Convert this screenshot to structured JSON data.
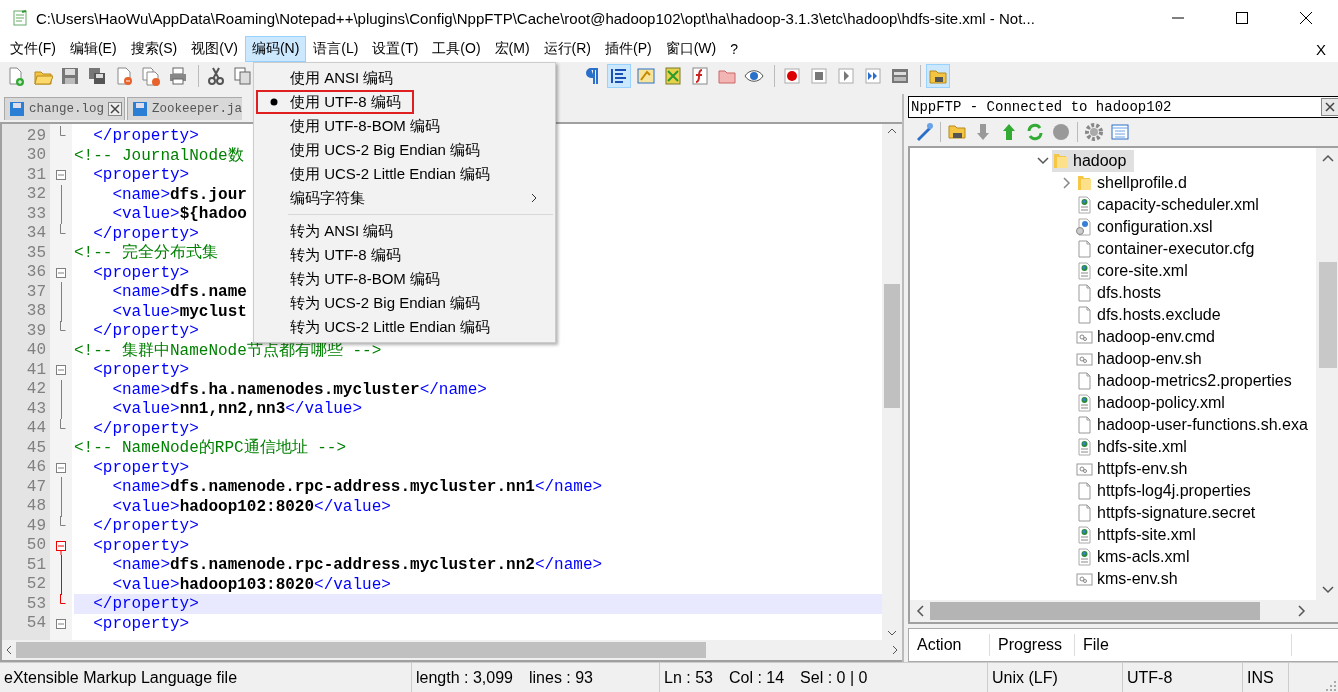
{
  "window": {
    "title": "C:\\Users\\HaoWu\\AppData\\Roaming\\Notepad++\\plugins\\Config\\NppFTP\\Cache\\root@hadoop102\\opt\\ha\\hadoop-3.1.3\\etc\\hadoop\\hdfs-site.xml - Not..."
  },
  "menu_bar": {
    "items": [
      {
        "label": "文件(F)",
        "selected": false
      },
      {
        "label": "编辑(E)",
        "selected": false
      },
      {
        "label": "搜索(S)",
        "selected": false
      },
      {
        "label": "视图(V)",
        "selected": false
      },
      {
        "label": "编码(N)",
        "selected": true
      },
      {
        "label": "语言(L)",
        "selected": false
      },
      {
        "label": "设置(T)",
        "selected": false
      },
      {
        "label": "工具(O)",
        "selected": false
      },
      {
        "label": "宏(M)",
        "selected": false
      },
      {
        "label": "运行(R)",
        "selected": false
      },
      {
        "label": "插件(P)",
        "selected": false
      },
      {
        "label": "窗口(W)",
        "selected": false
      },
      {
        "label": "?",
        "selected": false
      }
    ],
    "close_label": "X"
  },
  "tabs": [
    {
      "label": "change.log",
      "selected": false
    },
    {
      "label": "Zookeeper.ja",
      "selected": false
    }
  ],
  "encoding_menu": [
    {
      "kind": "item",
      "label": "使用 ANSI 编码",
      "checked": false,
      "outlined": false
    },
    {
      "kind": "item",
      "label": "使用 UTF-8 编码",
      "checked": true,
      "outlined": true
    },
    {
      "kind": "item",
      "label": "使用 UTF-8-BOM 编码",
      "checked": false,
      "outlined": false
    },
    {
      "kind": "item",
      "label": "使用 UCS-2 Big Endian 编码",
      "checked": false,
      "outlined": false
    },
    {
      "kind": "item",
      "label": "使用 UCS-2 Little Endian 编码",
      "checked": false,
      "outlined": false
    },
    {
      "kind": "submenu",
      "label": "编码字符集",
      "checked": false,
      "outlined": false
    },
    {
      "kind": "separator"
    },
    {
      "kind": "item",
      "label": "转为 ANSI 编码",
      "checked": false,
      "outlined": false
    },
    {
      "kind": "item",
      "label": "转为 UTF-8 编码",
      "checked": false,
      "outlined": false
    },
    {
      "kind": "item",
      "label": "转为 UTF-8-BOM 编码",
      "checked": false,
      "outlined": false
    },
    {
      "kind": "item",
      "label": "转为 UCS-2 Big Endian 编码",
      "checked": false,
      "outlined": false
    },
    {
      "kind": "item",
      "label": "转为 UCS-2 Little Endian 编码",
      "checked": false,
      "outlined": false
    }
  ],
  "editor": {
    "lines": [
      {
        "number": "29",
        "kind": "end",
        "current": false,
        "segments": [
          {
            "kind": "tag",
            "text": "  </property>"
          }
        ]
      },
      {
        "number": "30",
        "kind": "plain",
        "current": false,
        "segments": [
          {
            "kind": "comment",
            "text": "<!-- JournalNode数"
          }
        ]
      },
      {
        "number": "31",
        "kind": "start",
        "current": false,
        "segments": [
          {
            "kind": "tag",
            "text": "  <property>"
          }
        ]
      },
      {
        "number": "32",
        "kind": "mid",
        "current": false,
        "segments": [
          {
            "kind": "tag",
            "text": "    <name>"
          },
          {
            "kind": "value",
            "text": "dfs.jour"
          }
        ]
      },
      {
        "number": "33",
        "kind": "mid",
        "current": false,
        "segments": [
          {
            "kind": "tag",
            "text": "    <value>"
          },
          {
            "kind": "value",
            "text": "${hadoo"
          }
        ]
      },
      {
        "number": "34",
        "kind": "end",
        "current": false,
        "segments": [
          {
            "kind": "tag",
            "text": "  </property>"
          }
        ]
      },
      {
        "number": "35",
        "kind": "plain",
        "current": false,
        "segments": [
          {
            "kind": "comment",
            "text": "<!-- 完全分布式集"
          }
        ]
      },
      {
        "number": "36",
        "kind": "start",
        "current": false,
        "segments": [
          {
            "kind": "tag",
            "text": "  <property>"
          }
        ]
      },
      {
        "number": "37",
        "kind": "mid",
        "current": false,
        "segments": [
          {
            "kind": "tag",
            "text": "    <name>"
          },
          {
            "kind": "value",
            "text": "dfs.name"
          }
        ]
      },
      {
        "number": "38",
        "kind": "mid",
        "current": false,
        "segments": [
          {
            "kind": "tag",
            "text": "    <value>"
          },
          {
            "kind": "value",
            "text": "myclust"
          }
        ]
      },
      {
        "number": "39",
        "kind": "end",
        "current": false,
        "segments": [
          {
            "kind": "tag",
            "text": "  </property>"
          }
        ]
      },
      {
        "number": "40",
        "kind": "plain",
        "current": false,
        "segments": [
          {
            "kind": "comment",
            "text": "<!-- 集群中NameNode节点都有哪些 -->"
          }
        ]
      },
      {
        "number": "41",
        "kind": "start",
        "current": false,
        "segments": [
          {
            "kind": "tag",
            "text": "  <property>"
          }
        ]
      },
      {
        "number": "42",
        "kind": "mid",
        "current": false,
        "segments": [
          {
            "kind": "tag",
            "text": "    <name>"
          },
          {
            "kind": "value",
            "text": "dfs.ha.namenodes.mycluster"
          },
          {
            "kind": "tag",
            "text": "</name>"
          }
        ]
      },
      {
        "number": "43",
        "kind": "mid",
        "current": false,
        "segments": [
          {
            "kind": "tag",
            "text": "    <value>"
          },
          {
            "kind": "value",
            "text": "nn1,nn2,nn3"
          },
          {
            "kind": "tag",
            "text": "</value>"
          }
        ]
      },
      {
        "number": "44",
        "kind": "end",
        "current": false,
        "segments": [
          {
            "kind": "tag",
            "text": "  </property>"
          }
        ]
      },
      {
        "number": "45",
        "kind": "plain",
        "current": false,
        "segments": [
          {
            "kind": "comment",
            "text": "<!-- NameNode的RPC通信地址 -->"
          }
        ]
      },
      {
        "number": "46",
        "kind": "start",
        "current": false,
        "segments": [
          {
            "kind": "tag",
            "text": "  <property>"
          }
        ]
      },
      {
        "number": "47",
        "kind": "mid",
        "current": false,
        "segments": [
          {
            "kind": "tag",
            "text": "    <name>"
          },
          {
            "kind": "value",
            "text": "dfs.namenode.rpc-address.mycluster.nn1"
          },
          {
            "kind": "tag",
            "text": "</name>"
          }
        ]
      },
      {
        "number": "48",
        "kind": "mid",
        "current": false,
        "segments": [
          {
            "kind": "tag",
            "text": "    <value>"
          },
          {
            "kind": "value",
            "text": "hadoop102:8020"
          },
          {
            "kind": "tag",
            "text": "</value>"
          }
        ]
      },
      {
        "number": "49",
        "kind": "end",
        "current": false,
        "segments": [
          {
            "kind": "tag",
            "text": "  </property>"
          }
        ]
      },
      {
        "number": "50",
        "kind": "start-active",
        "current": false,
        "segments": [
          {
            "kind": "tag",
            "text": "  <property>"
          }
        ]
      },
      {
        "number": "51",
        "kind": "mid-active",
        "current": false,
        "segments": [
          {
            "kind": "tag",
            "text": "    <name>"
          },
          {
            "kind": "value",
            "text": "dfs.namenode.rpc-address.mycluster.nn2"
          },
          {
            "kind": "tag",
            "text": "</name>"
          }
        ]
      },
      {
        "number": "52",
        "kind": "mid-active",
        "current": false,
        "segments": [
          {
            "kind": "tag",
            "text": "    <value>"
          },
          {
            "kind": "value",
            "text": "hadoop103:8020"
          },
          {
            "kind": "tag",
            "text": "</value>"
          }
        ]
      },
      {
        "number": "53",
        "kind": "end-active",
        "current": true,
        "segments": [
          {
            "kind": "tag",
            "text": "  </property>"
          }
        ]
      },
      {
        "number": "54",
        "kind": "start",
        "current": false,
        "segments": [
          {
            "kind": "tag",
            "text": "  <property>"
          }
        ]
      }
    ]
  },
  "ftp_panel": {
    "title": "NppFTP - Connected to hadoop102",
    "tree": [
      {
        "label": "hadoop",
        "kind": "folder",
        "expanded": true,
        "selected": true,
        "children": [
          {
            "label": "shellprofile.d",
            "kind": "folder",
            "expanded": false,
            "selected": false
          },
          {
            "label": "capacity-scheduler.xml",
            "kind": "xml",
            "selected": false
          },
          {
            "label": "configuration.xsl",
            "kind": "xsl",
            "selected": false
          },
          {
            "label": "container-executor.cfg",
            "kind": "file",
            "selected": false
          },
          {
            "label": "core-site.xml",
            "kind": "xml",
            "selected": false
          },
          {
            "label": "dfs.hosts",
            "kind": "file",
            "selected": false
          },
          {
            "label": "dfs.hosts.exclude",
            "kind": "file",
            "selected": false
          },
          {
            "label": "hadoop-env.cmd",
            "kind": "script",
            "selected": false
          },
          {
            "label": "hadoop-env.sh",
            "kind": "script",
            "selected": false
          },
          {
            "label": "hadoop-metrics2.properties",
            "kind": "file",
            "selected": false
          },
          {
            "label": "hadoop-policy.xml",
            "kind": "xml",
            "selected": false
          },
          {
            "label": "hadoop-user-functions.sh.exa",
            "kind": "file",
            "selected": false
          },
          {
            "label": "hdfs-site.xml",
            "kind": "xml",
            "selected": false
          },
          {
            "label": "httpfs-env.sh",
            "kind": "script",
            "selected": false
          },
          {
            "label": "httpfs-log4j.properties",
            "kind": "file",
            "selected": false
          },
          {
            "label": "httpfs-signature.secret",
            "kind": "file",
            "selected": false
          },
          {
            "label": "httpfs-site.xml",
            "kind": "xml",
            "selected": false
          },
          {
            "label": "kms-acls.xml",
            "kind": "xml",
            "selected": false
          },
          {
            "label": "kms-env.sh",
            "kind": "script",
            "selected": false
          }
        ]
      }
    ],
    "queue_columns": [
      "Action",
      "Progress",
      "File"
    ]
  },
  "status_bar": {
    "cells": [
      {
        "texts": [
          "eXtensible Markup Language file"
        ]
      },
      {
        "texts": [
          "length : 3,099",
          "lines : 93"
        ]
      },
      {
        "texts": [
          "Ln : 53",
          "Col : 14",
          "Sel : 0 | 0"
        ]
      },
      {
        "texts": [
          "Unix (LF)"
        ]
      },
      {
        "texts": [
          "UTF-8"
        ]
      },
      {
        "texts": [
          "INS"
        ]
      }
    ]
  }
}
